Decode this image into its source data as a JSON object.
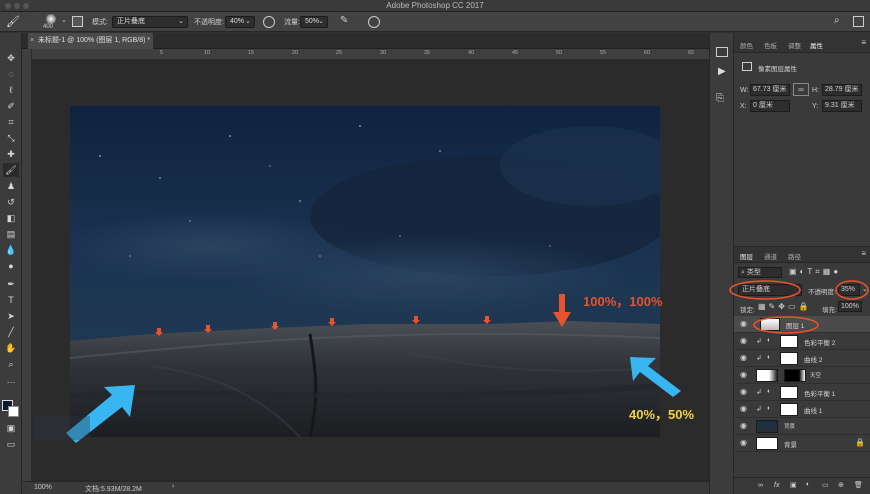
{
  "app_title": "Adobe Photoshop CC 2017",
  "options": {
    "brush_size": "400",
    "mode_label": "模式:",
    "mode_value": "正片叠底",
    "opacity_label": "不透明度:",
    "opacity_value": "40%",
    "flow_label": "流量:",
    "flow_value": "50%"
  },
  "document_tab": "未标题-1 @ 100% (图层 1, RGB/8) *",
  "ruler_ticks": [
    "5",
    "10",
    "15",
    "20",
    "25",
    "30",
    "35",
    "40",
    "45",
    "50",
    "55",
    "60",
    "65"
  ],
  "status": {
    "zoom": "100%",
    "doc_size": "文档:5.93M/28.2M"
  },
  "properties": {
    "tabs": [
      "颜色",
      "色板",
      "调整",
      "属性"
    ],
    "active_tab": "属性",
    "header": "像素图层属性",
    "w_label": "W:",
    "w_value": "67.73 厘米",
    "h_label": "H:",
    "h_value": "28.79 厘米",
    "x_label": "X:",
    "x_value": "0 厘米",
    "y_label": "Y:",
    "y_value": "9.31 厘米"
  },
  "layers_panel": {
    "tabs": [
      "图层",
      "通道",
      "路径"
    ],
    "filter_label": "类型",
    "blend_mode": "正片叠底",
    "opacity_label": "不透明度:",
    "opacity_value": "35%",
    "lock_label": "锁定:",
    "fill_label": "填充:",
    "fill_value": "100%",
    "layers": [
      {
        "name": "图层 1"
      },
      {
        "name": "色彩平衡 2"
      },
      {
        "name": "曲线 2"
      },
      {
        "name": "天空"
      },
      {
        "name": "色彩平衡 1"
      },
      {
        "name": "曲线 1"
      },
      {
        "name": "背景"
      },
      {
        "name": "背景"
      }
    ]
  },
  "annotations": {
    "top_right": "100%，100%",
    "bottom_right": "40%，50%"
  },
  "colors": {
    "annotation_red": "#e8532b",
    "annotation_yellow": "#f2d24a",
    "arrow_blue": "#38b6f1",
    "highlight_circle": "#e8532b"
  }
}
